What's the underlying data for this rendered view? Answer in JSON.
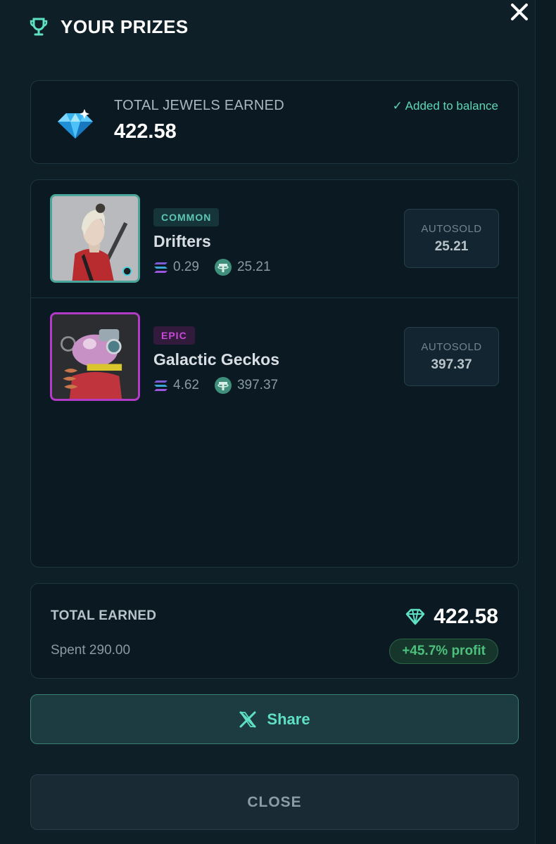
{
  "header": {
    "title": "YOUR PRIZES",
    "trophy_icon": "trophy-icon",
    "close_icon": "close-icon"
  },
  "jewels": {
    "label": "TOTAL JEWELS EARNED",
    "value": "422.58",
    "status": "✓ Added to balance",
    "icon": "diamond-icon"
  },
  "prizes": [
    {
      "rarity": "COMMON",
      "name": "Drifters",
      "sol_value": "0.29",
      "usdt_value": "25.21",
      "autosold_label": "AUTOSOLD",
      "autosold_value": "25.21"
    },
    {
      "rarity": "EPIC",
      "name": "Galactic Geckos",
      "sol_value": "4.62",
      "usdt_value": "397.37",
      "autosold_label": "AUTOSOLD",
      "autosold_value": "397.37"
    }
  ],
  "summary": {
    "total_label": "TOTAL EARNED",
    "total_value": "422.58",
    "spent": "Spent 290.00",
    "profit": "+45.7% profit"
  },
  "actions": {
    "share_label": "Share",
    "close_label": "CLOSE"
  },
  "colors": {
    "background": "#0f1f27",
    "accent": "#5fe0c4",
    "common": "#5ec7b4",
    "epic": "#c74bd6",
    "profit": "#4cc07c"
  }
}
